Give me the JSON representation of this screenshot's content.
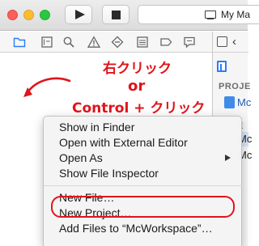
{
  "toolbar": {
    "scheme_label": "My Ma"
  },
  "navigator": {
    "icons": [
      "folder-icon",
      "source-control-icon",
      "search-icon",
      "warning-icon",
      "test-diamond-icon",
      "debug-list-icon",
      "breakpoint-icon",
      "report-icon"
    ]
  },
  "annotation": {
    "line1": "右クリック",
    "line2": "or",
    "line3": "Control + クリック",
    "color": "#e0141b"
  },
  "context_menu": {
    "items": [
      {
        "label": "Show in Finder"
      },
      {
        "label": "Open with External Editor"
      },
      {
        "label": "Open As",
        "has_submenu": true
      },
      {
        "label": "Show File Inspector"
      },
      {
        "label": "New File…"
      },
      {
        "label": "New Project…"
      },
      {
        "label": "Add Files to “McWorkspace”…"
      }
    ]
  },
  "inspector": {
    "section_header": "PROJE",
    "project_name": "Mc",
    "section_header_2": "E",
    "row1": "Mc",
    "row2": "Mc"
  }
}
